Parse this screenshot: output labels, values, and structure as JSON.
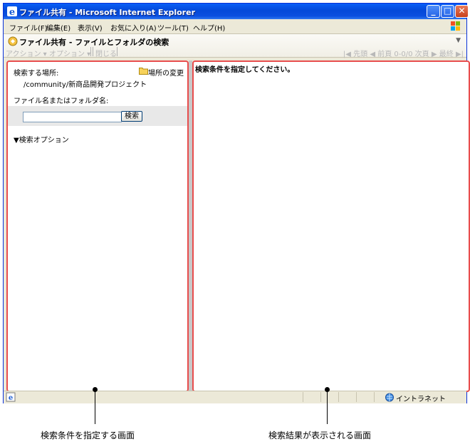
{
  "window": {
    "title": "ファイル共有 - Microsoft Internet Explorer"
  },
  "menu": [
    "ファイル(F)",
    "編集(E)",
    "表示(V)",
    "お気に入り(A)",
    "ツール(T)",
    "ヘルプ(H)"
  ],
  "header": {
    "title": "ファイル共有 - ファイルとフォルダの検索"
  },
  "toolbar": {
    "action": "アクション ▾",
    "option": "オプション ▾",
    "close": "閉じる"
  },
  "pager": {
    "first": "先頭",
    "prev": "前頁",
    "range": "0-0/0",
    "next": "次頁",
    "last": "最終"
  },
  "left": {
    "location_label": "検索する場所:",
    "change_location": "場所の変更",
    "location_path": "/community/新商品開発プロジェクト",
    "name_label": "ファイル名またはフォルダ名:",
    "search_value": "",
    "search_button": "検索",
    "options": "検索オプション"
  },
  "right": {
    "message": "検索条件を指定してください。"
  },
  "status": {
    "zone": "イントラネット"
  },
  "captions": {
    "left": "検索条件を指定する画面",
    "right": "検索結果が表示される画面"
  },
  "colors": {
    "titlebar": "#0a5ef7",
    "pane_border": "#e84d4d"
  }
}
